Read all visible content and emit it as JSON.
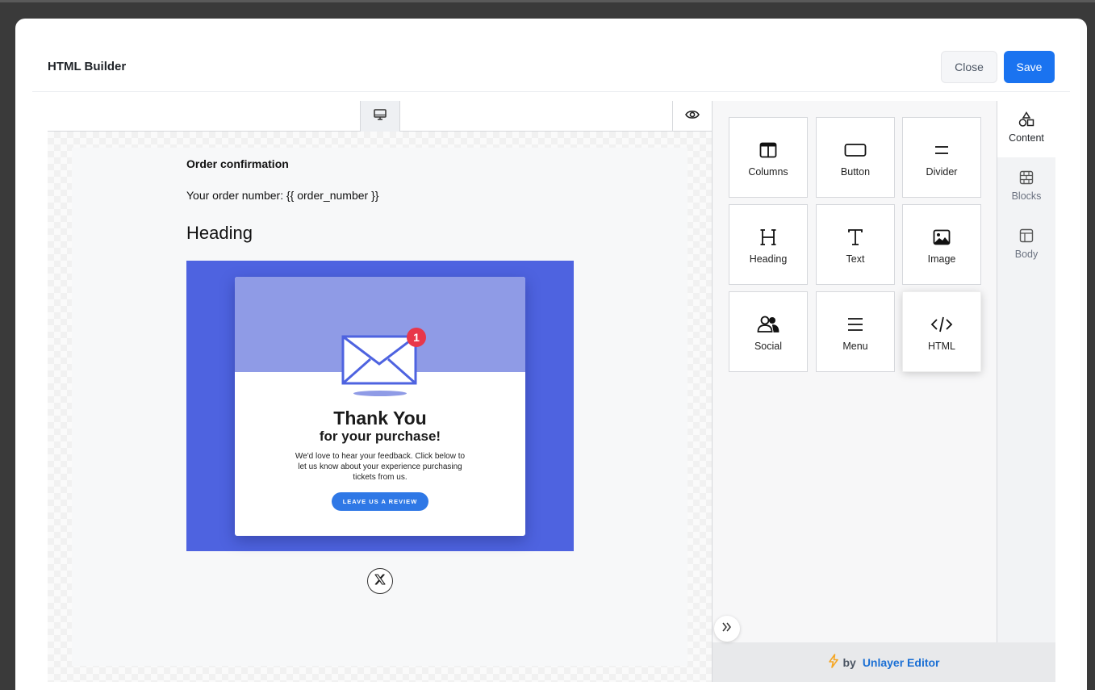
{
  "modal": {
    "title": "HTML Builder",
    "close_label": "Close",
    "save_label": "Save"
  },
  "toolbar": {
    "device_icon": "desktop-icon",
    "preview_icon": "eye-icon"
  },
  "email": {
    "order_title": "Order confirmation",
    "order_number_text": "Your order number: {{ order_number }}",
    "heading": "Heading",
    "hero": {
      "title": "Thank You",
      "subtitle": "for your purchase!",
      "body": "We'd love to hear your feedback. Click below to let us know about your experience purchasing tickets from us.",
      "button": "LEAVE US A REVIEW",
      "badge": "1"
    },
    "social_icon": "x-icon"
  },
  "tools": [
    {
      "label": "Columns",
      "icon": "columns-icon"
    },
    {
      "label": "Button",
      "icon": "button-icon"
    },
    {
      "label": "Divider",
      "icon": "divider-icon"
    },
    {
      "label": "Heading",
      "icon": "heading-icon"
    },
    {
      "label": "Text",
      "icon": "text-icon"
    },
    {
      "label": "Image",
      "icon": "image-icon"
    },
    {
      "label": "Social",
      "icon": "social-icon"
    },
    {
      "label": "Menu",
      "icon": "menu-icon"
    },
    {
      "label": "HTML",
      "icon": "html-icon"
    }
  ],
  "nav": [
    {
      "label": "Content",
      "icon": "shapes-icon"
    },
    {
      "label": "Blocks",
      "icon": "blocks-icon"
    },
    {
      "label": "Body",
      "icon": "body-layout-icon"
    }
  ],
  "footer": {
    "by": "by",
    "brand": "Unlayer Editor",
    "icon": "lightning-icon"
  },
  "colors": {
    "primary": "#1a73f0",
    "hero_bg": "#4e63e0",
    "hero_card_top": "#8f9be6",
    "badge": "#e8374a",
    "brand_link": "#1a6fd4",
    "lightning": "#f5a623"
  }
}
